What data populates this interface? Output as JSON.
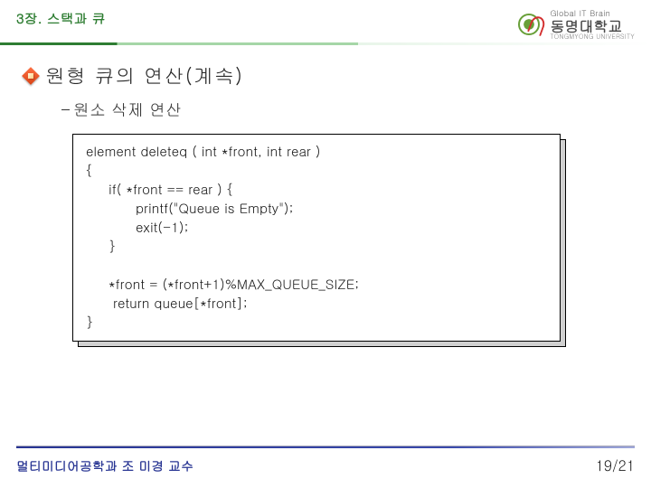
{
  "header": {
    "chapter_title": "3장. 스택과 큐",
    "logo": {
      "tagline": "Global IT Brain",
      "university": "동명대학교",
      "eng": "TONGMYONG UNIVERSITY"
    }
  },
  "main": {
    "title": "원형 큐의 연산(계속)",
    "subtitle_dash": "–",
    "subtitle": "원소 삭제 연산"
  },
  "code": {
    "lines": "element deleteq ( int *front, int rear )\n{\n     if( *front == rear ) {\n           printf(\"Queue is Empty\");\n           exit(-1);\n     }\n\n     *front = (*front+1)%MAX_QUEUE_SIZE;\n      return queue[*front];\n}"
  },
  "footer": {
    "department": "멀티미디어공학과   조 미경 교수",
    "page": "19/21"
  }
}
